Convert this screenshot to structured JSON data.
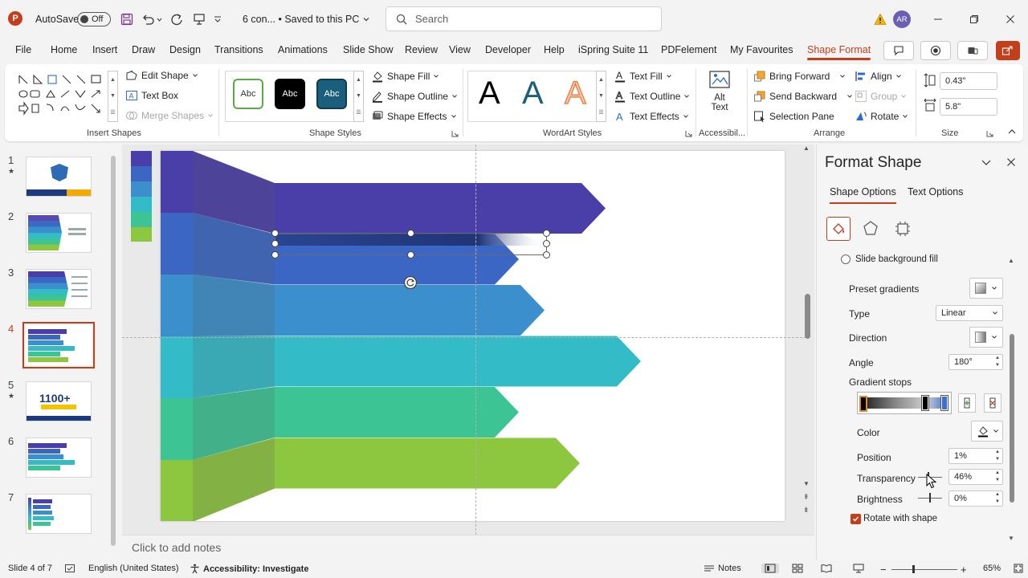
{
  "titlebar": {
    "autosave_label": "AutoSave",
    "autosave_state": "Off",
    "filename": "6 con... • Saved to this PC",
    "search_placeholder": "Search",
    "user_initials": "AR"
  },
  "menu": {
    "tabs": [
      "File",
      "Home",
      "Insert",
      "Draw",
      "Design",
      "Transitions",
      "Animations",
      "Slide Show",
      "Review",
      "View",
      "Developer",
      "Help",
      "iSpring Suite 11",
      "PDFelement",
      "My Favourites",
      "Shape Format"
    ]
  },
  "ribbon": {
    "insert_shapes": {
      "label": "Insert Shapes",
      "edit_shape": "Edit Shape",
      "text_box": "Text Box",
      "merge_shapes": "Merge Shapes"
    },
    "shape_styles": {
      "label": "Shape Styles",
      "preset_text": "Abc",
      "shape_fill": "Shape Fill",
      "shape_outline": "Shape Outline",
      "shape_effects": "Shape Effects"
    },
    "wordart": {
      "label": "WordArt Styles",
      "letter": "A",
      "text_fill": "Text Fill",
      "text_outline": "Text Outline",
      "text_effects": "Text Effects"
    },
    "accessibility": {
      "label": "Accessibil...",
      "alt_text_line1": "Alt",
      "alt_text_line2": "Text"
    },
    "arrange": {
      "label": "Arrange",
      "bring_forward": "Bring Forward",
      "send_backward": "Send Backward",
      "selection_pane": "Selection Pane",
      "align": "Align",
      "group": "Group",
      "rotate": "Rotate"
    },
    "size": {
      "label": "Size",
      "height": "0.43\"",
      "width": "5.8\""
    }
  },
  "thumbnails": {
    "slides": [
      {
        "num": "1",
        "star": true
      },
      {
        "num": "2",
        "star": false
      },
      {
        "num": "3",
        "star": false
      },
      {
        "num": "4",
        "star": false
      },
      {
        "num": "5",
        "star": true,
        "big_text": "1100+"
      },
      {
        "num": "6",
        "star": false
      },
      {
        "num": "7",
        "star": false
      }
    ]
  },
  "slide": {
    "bar_colors": [
      "#4a3fa8",
      "#3b66c4",
      "#3a8fcc",
      "#33bcc8",
      "#3dc495",
      "#8dc63f"
    ],
    "notes_placeholder": "Click to add notes"
  },
  "format_pane": {
    "title": "Format Shape",
    "tab_shape_options": "Shape Options",
    "tab_text_options": "Text Options",
    "slide_background_fill": "Slide background fill",
    "preset_gradients": "Preset gradients",
    "type_label": "Type",
    "type_value": "Linear",
    "direction_label": "Direction",
    "angle_label": "Angle",
    "angle_value": "180°",
    "gradient_stops_label": "Gradient stops",
    "color_label": "Color",
    "position_label": "Position",
    "position_value": "1%",
    "transparency_label": "Transparency",
    "transparency_value": "46%",
    "brightness_label": "Brightness",
    "brightness_value": "0%",
    "rotate_with_shape": "Rotate with shape"
  },
  "statusbar": {
    "slide_info": "Slide 4 of 7",
    "language": "English (United States)",
    "accessibility": "Accessibility: Investigate",
    "notes": "Notes",
    "zoom": "65%"
  }
}
